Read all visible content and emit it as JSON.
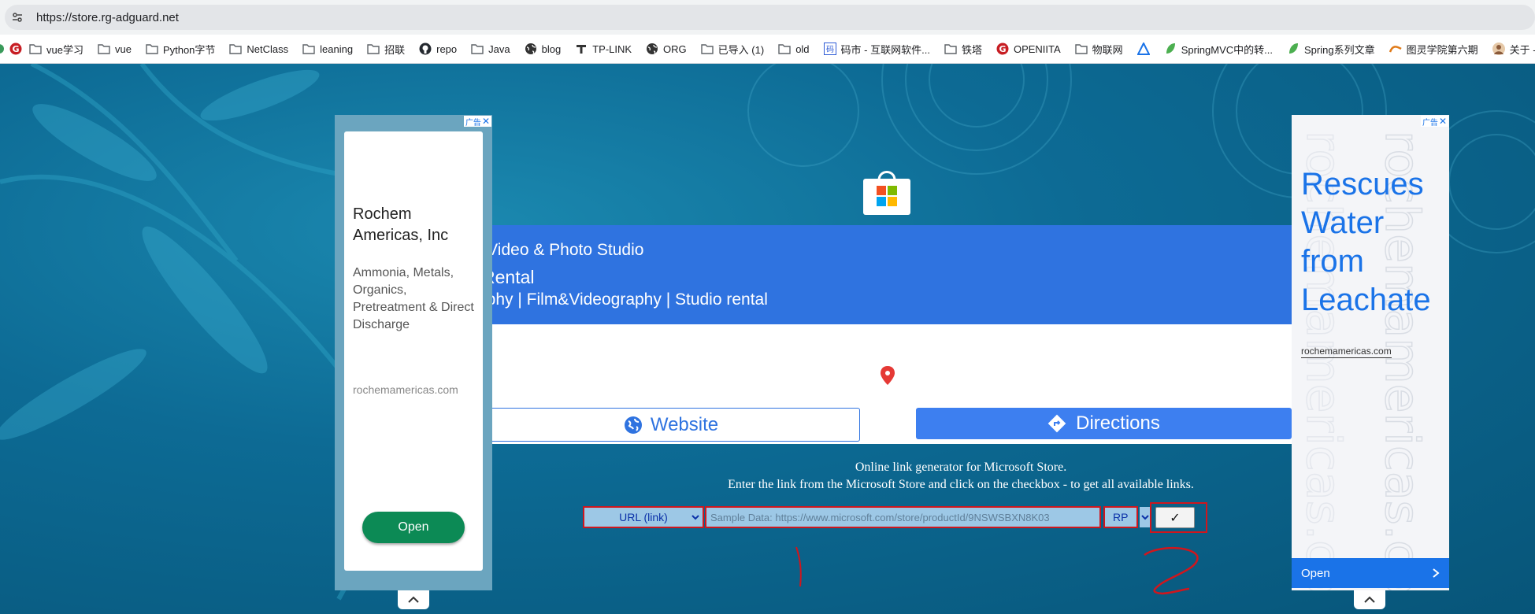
{
  "browser": {
    "url": "https://store.rg-adguard.net",
    "bookmarks": [
      {
        "label": "vue学习",
        "icon": "folder-icon"
      },
      {
        "label": "vue",
        "icon": "folder-icon"
      },
      {
        "label": "Python字节",
        "icon": "folder-icon"
      },
      {
        "label": "NetClass",
        "icon": "folder-icon"
      },
      {
        "label": "leaning",
        "icon": "folder-icon"
      },
      {
        "label": "招联",
        "icon": "folder-icon"
      },
      {
        "label": "repo",
        "icon": "github-icon"
      },
      {
        "label": "Java",
        "icon": "folder-icon"
      },
      {
        "label": "blog",
        "icon": "globe-icon"
      },
      {
        "label": "TP-LINK",
        "icon": "tp-link-icon"
      },
      {
        "label": "ORG",
        "icon": "globe-icon"
      },
      {
        "label": "已导入 (1)",
        "icon": "folder-icon"
      },
      {
        "label": "old",
        "icon": "folder-icon"
      },
      {
        "label": "码市 - 互联网软件...",
        "icon": "mashi-icon"
      },
      {
        "label": "铁塔",
        "icon": "folder-icon"
      },
      {
        "label": "OPENIITA",
        "icon": "openiita-icon"
      },
      {
        "label": "物联网",
        "icon": "folder-icon"
      },
      {
        "label": "",
        "icon": "triangle-logo-icon"
      },
      {
        "label": "SpringMVC中的转...",
        "icon": "spring-leaf-icon"
      },
      {
        "label": "Spring系列文章",
        "icon": "spring-leaf-icon"
      },
      {
        "label": "图灵学院第六期",
        "icon": "tuling-icon"
      },
      {
        "label": "关于 - 我 |...",
        "icon": "avatar-icon"
      }
    ]
  },
  "store": {
    "banner_line1": "O Video & Photo Studio",
    "banner_line2": "Rental",
    "banner_line3": "raphy | Film&Videography | Studio rental",
    "website_label": "Website",
    "directions_label": "Directions"
  },
  "generator": {
    "line1": "Online link generator for Microsoft Store.",
    "line2": "Enter the link from the Microsoft Store and click on the checkbox - to get all available links.",
    "type_selected": "URL (link)",
    "input_placeholder": "Sample Data: https://www.microsoft.com/store/productId/9NSWSBXN8K03",
    "ring_selected": "RP",
    "submit_label": "✓"
  },
  "ad_left": {
    "badge": "广告",
    "title": "Rochem Americas, Inc",
    "description": "Ammonia, Metals, Organics, Pretreatment & Direct Discharge",
    "domain": "rochemamericas.com",
    "open_label": "Open"
  },
  "ad_right": {
    "badge": "广告",
    "title": "Rescues Water from Leachate",
    "domain": "rochemamericas.com",
    "open_label": "Open",
    "watermark": "rochemamericas.com"
  },
  "colors": {
    "banner": "#2f73e0",
    "directions": "#3d7ff0",
    "highlight_red": "#d0161d",
    "input_bg": "#9dc8e6",
    "ad_open_green": "#0c8a55",
    "ad_blue": "#1a73e8"
  }
}
